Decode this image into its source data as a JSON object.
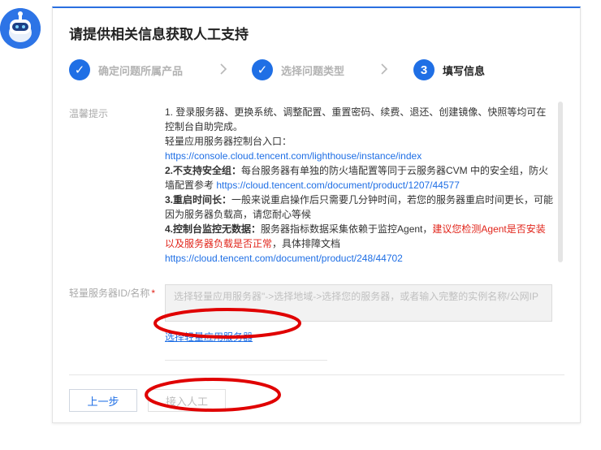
{
  "dialog": {
    "title": "请提供相关信息获取人工支持"
  },
  "steps": [
    {
      "label": "确定问题所属产品",
      "marker": "✓"
    },
    {
      "label": "选择问题类型",
      "marker": "✓"
    },
    {
      "label": "填写信息",
      "marker": "3"
    }
  ],
  "tips": {
    "label": "温馨提示",
    "l1": "1. 登录服务器、更换系统、调整配置、重置密码、续费、退还、创建镜像、快照等均可在控制台自助完成。",
    "l2": "轻量应用服务器控制台入口：",
    "l3_link": "https://console.cloud.tencent.com/lighthouse/instance/index",
    "l4_bold": "2.不支持安全组：",
    "l4_text": "每台服务器有单独的防火墙配置等同于云服务器CVM 中的安全组，防火墙配置参考 ",
    "l4_link": "https://cloud.tencent.com/document/product/1207/44577",
    "l5_bold": "3.重启时间长：",
    "l5_text": "一般来说重启操作后只需要几分钟时间，若您的服务器重启时间更长，可能因为服务器负载高，请您耐心等候",
    "l6_bold": "4.控制台监控无数据：",
    "l6_text": "服务器指标数据采集依赖于监控Agent，",
    "l6_warn": "建议您检测Agent是否安装以及服务器负载是否正常",
    "l6_text2": "，具体排障文档 ",
    "l6_link": "https://cloud.tencent.com/document/product/248/44702"
  },
  "server_field": {
    "label": "轻量服务器ID/名称",
    "required_mark": "*",
    "placeholder": "选择轻量应用服务器\"->选择地域->选择您的服务器，或者输入完整的实例名称/公网IP",
    "select_link": "选择轻量应用服务器"
  },
  "buttons": {
    "prev": "上一步",
    "submit": "接入人工"
  },
  "colors": {
    "accent": "#1f6fe5",
    "warning": "#e1251b",
    "annotation": "#e00000"
  }
}
